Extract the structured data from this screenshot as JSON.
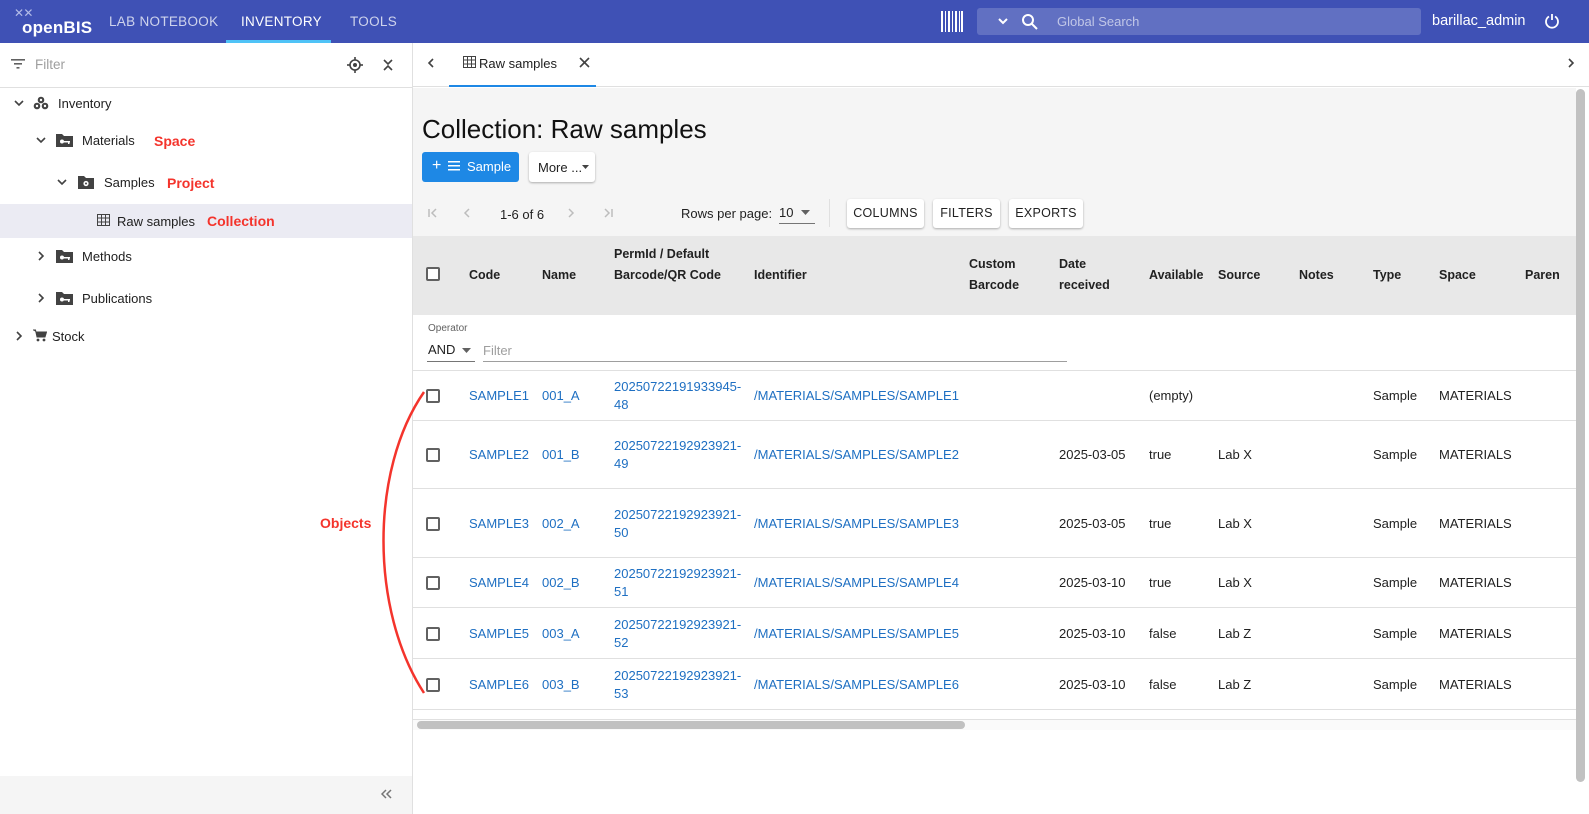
{
  "app": {
    "logo_text": "openBIS",
    "nav_tabs": [
      "LAB NOTEBOOK",
      "INVENTORY",
      "TOOLS"
    ],
    "active_tab": "INVENTORY",
    "search_placeholder": "Global Search",
    "user": "barillac_admin"
  },
  "sidebar": {
    "filter_placeholder": "Filter",
    "tree": [
      {
        "label": "Inventory",
        "icon": "inventory-icon",
        "expanded": true
      },
      {
        "label": "Materials",
        "icon": "space-icon",
        "expanded": true,
        "annotation": "Space"
      },
      {
        "label": "Samples",
        "icon": "project-icon",
        "expanded": true,
        "annotation": "Project"
      },
      {
        "label": "Raw samples",
        "icon": "table-icon",
        "selected": true,
        "annotation": "Collection"
      },
      {
        "label": "Methods",
        "icon": "space-icon",
        "expanded": false
      },
      {
        "label": "Publications",
        "icon": "space-icon",
        "expanded": false
      },
      {
        "label": "Stock",
        "icon": "cart-icon",
        "expanded": false
      }
    ]
  },
  "main": {
    "tab_label": "Raw samples",
    "title": "Collection: Raw samples",
    "add_button": "Sample",
    "more_button": "More ...",
    "pagination": {
      "range": "1-6 of 6",
      "rows_label": "Rows per page:",
      "rows_value": "10"
    },
    "toolbar_buttons": [
      "COLUMNS",
      "FILTERS",
      "EXPORTS"
    ],
    "columns": [
      "Code",
      "Name",
      "PermId / Default Barcode/QR Code",
      "Identifier",
      "Custom Barcode",
      "Date received",
      "Available",
      "Source",
      "Notes",
      "Type",
      "Space",
      "Paren"
    ],
    "filter": {
      "operator_label": "Operator",
      "operator_value": "AND",
      "placeholder": "Filter"
    },
    "rows": [
      {
        "code": "SAMPLE1",
        "name": "001_A",
        "permid_1": "20250722191933945-",
        "permid_2": "48",
        "identifier": "/MATERIALS/SAMPLES/SAMPLE1",
        "date": "",
        "available": "(empty)",
        "source": "",
        "type": "Sample",
        "space": "MATERIALS"
      },
      {
        "code": "SAMPLE2",
        "name": "001_B",
        "permid_1": "20250722192923921-",
        "permid_2": "49",
        "identifier": "/MATERIALS/SAMPLES/SAMPLE2",
        "date": "2025-03-05",
        "available": "true",
        "source": "Lab X",
        "type": "Sample",
        "space": "MATERIALS"
      },
      {
        "code": "SAMPLE3",
        "name": "002_A",
        "permid_1": "20250722192923921-",
        "permid_2": "50",
        "identifier": "/MATERIALS/SAMPLES/SAMPLE3",
        "date": "2025-03-05",
        "available": "true",
        "source": "Lab X",
        "type": "Sample",
        "space": "MATERIALS"
      },
      {
        "code": "SAMPLE4",
        "name": "002_B",
        "permid_1": "20250722192923921-",
        "permid_2": "51",
        "identifier": "/MATERIALS/SAMPLES/SAMPLE4",
        "date": "2025-03-10",
        "available": "true",
        "source": "Lab X",
        "type": "Sample",
        "space": "MATERIALS"
      },
      {
        "code": "SAMPLE5",
        "name": "003_A",
        "permid_1": "20250722192923921-",
        "permid_2": "52",
        "identifier": "/MATERIALS/SAMPLES/SAMPLE5",
        "date": "2025-03-10",
        "available": "false",
        "source": "Lab Z",
        "type": "Sample",
        "space": "MATERIALS"
      },
      {
        "code": "SAMPLE6",
        "name": "003_B",
        "permid_1": "20250722192923921-",
        "permid_2": "53",
        "identifier": "/MATERIALS/SAMPLES/SAMPLE6",
        "date": "2025-03-10",
        "available": "false",
        "source": "Lab Z",
        "type": "Sample",
        "space": "MATERIALS"
      }
    ]
  },
  "annotations": {
    "objects": "Objects"
  },
  "colors": {
    "topbar": "#3f51b5",
    "accent": "#1e88e5",
    "link": "#1e6fc2",
    "annotation": "#f4342c"
  }
}
